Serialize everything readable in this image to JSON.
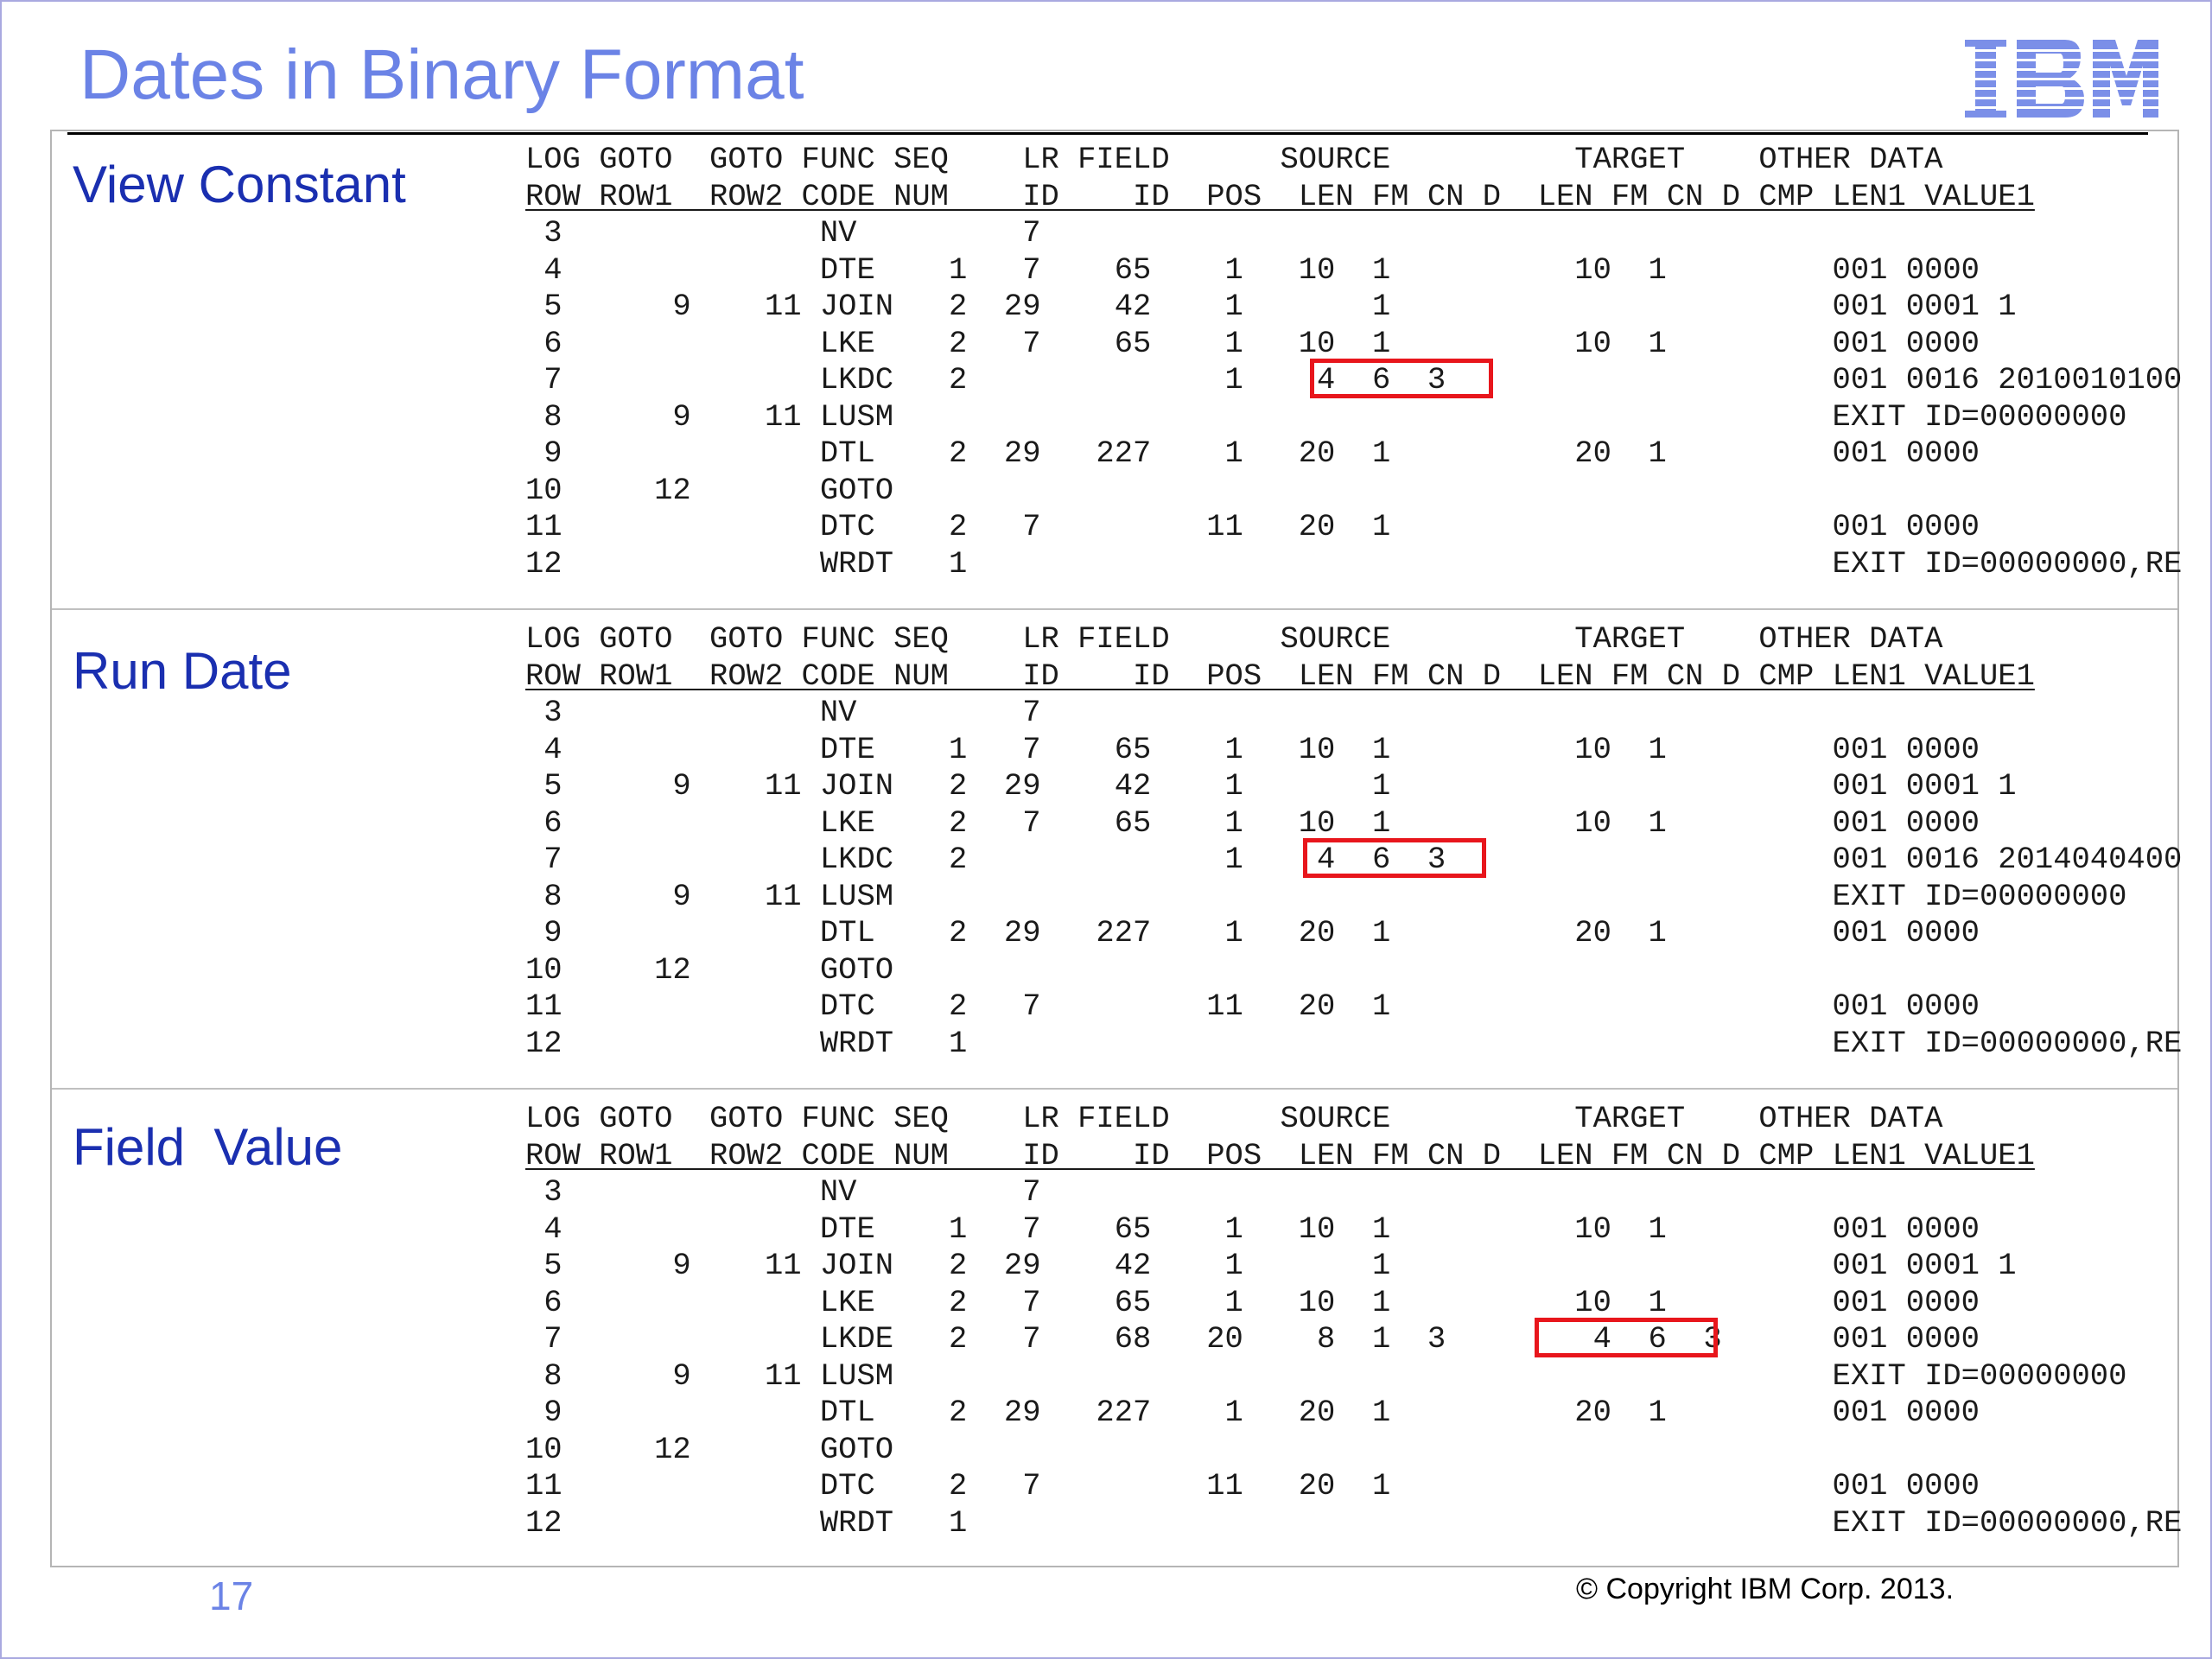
{
  "slide": {
    "title": "Dates in Binary Format",
    "logo_text": "IBM",
    "page_number": "17",
    "copyright": "© Copyright IBM Corp. 2013."
  },
  "colors": {
    "title": "#6b83e6",
    "section_label": "#1a2fb0",
    "highlight": "#e8161c",
    "logo": "#7b8fe8"
  },
  "header": {
    "line1": "LOG GOTO  GOTO FUNC SEQ    LR FIELD      SOURCE          TARGET    OTHER DATA",
    "line2": "ROW ROW1  ROW2 CODE NUM    ID    ID  POS  LEN FM CN D  LEN FM CN D CMP LEN1 VALUE1"
  },
  "sections": [
    {
      "label": "View Constant",
      "rows": [
        " 3              NV         7",
        " 4              DTE    1   7    65    1   10  1          10  1         001 0000",
        " 5      9    11 JOIN   2  29    42    1       1                        001 0001 1",
        " 6              LKE    2   7    65    1   10  1          10  1         001 0000",
        " 7              LKDC   2              1    4  6  3                     001 0016 2010010100",
        " 8      9    11 LUSM                                                   EXIT ID=00000000",
        " 9              DTL    2  29   227    1   20  1          20  1         001 0000",
        "10     12       GOTO",
        "11              DTC    2   7         11   20  1                        001 0000",
        "12              WRDT   1                                               EXIT ID=00000000,RE"
      ]
    },
    {
      "label": "Run Date",
      "rows": [
        " 3              NV         7",
        " 4              DTE    1   7    65    1   10  1          10  1         001 0000",
        " 5      9    11 JOIN   2  29    42    1       1                        001 0001 1",
        " 6              LKE    2   7    65    1   10  1          10  1         001 0000",
        " 7              LKDC   2              1    4  6  3                     001 0016 2014040400",
        " 8      9    11 LUSM                                                   EXIT ID=00000000",
        " 9              DTL    2  29   227    1   20  1          20  1         001 0000",
        "10     12       GOTO",
        "11              DTC    2   7         11   20  1                        001 0000",
        "12              WRDT   1                                               EXIT ID=00000000,RE"
      ]
    },
    {
      "label": "Field  Value",
      "rows": [
        " 3              NV         7",
        " 4              DTE    1   7    65    1   10  1          10  1         001 0000",
        " 5      9    11 JOIN   2  29    42    1       1                        001 0001 1",
        " 6              LKE    2   7    65    1   10  1          10  1         001 0000",
        " 7              LKDE   2   7    68   20    8  1  3        4  6  3      001 0000",
        " 8      9    11 LUSM                                                   EXIT ID=00000000",
        " 9              DTL    2  29   227    1   20  1          20  1         001 0000",
        "10     12       GOTO",
        "11              DTC    2   7         11   20  1                        001 0000",
        "12              WRDT   1                                               EXIT ID=00000000,RE"
      ]
    }
  ]
}
